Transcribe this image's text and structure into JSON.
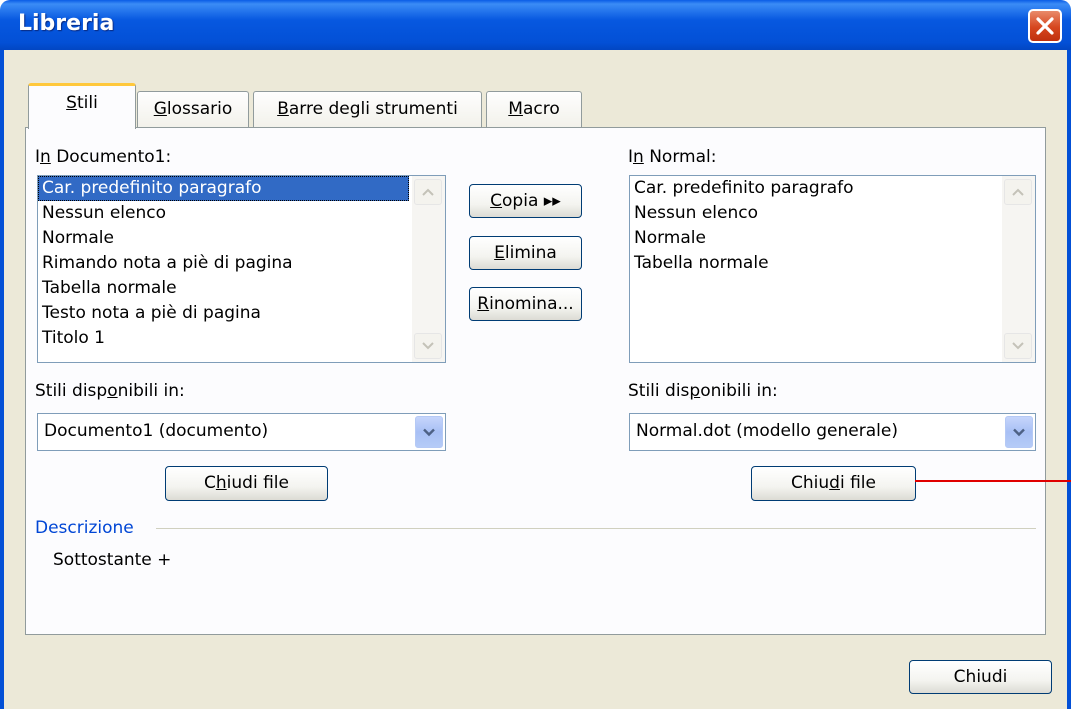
{
  "window": {
    "title": "Libreria"
  },
  "tabs": [
    {
      "label": "Stili",
      "mnemonic": "S",
      "rest": "tili",
      "active": true
    },
    {
      "label": "Glossario",
      "mnemonic": "G",
      "rest": "lossario",
      "active": false
    },
    {
      "label": "Barre degli strumenti",
      "mnemonic": "B",
      "rest": "arre degli strumenti",
      "active": false
    },
    {
      "label": "Macro",
      "mnemonic": "M",
      "rest": "acro",
      "active": false
    }
  ],
  "left": {
    "label_pre": "I",
    "label_mn": "n",
    "label_post": " Documento1:",
    "items": [
      "Car. predefinito paragrafo",
      "Nessun elenco",
      "Normale",
      "Rimando nota a piè di pagina",
      "Tabella normale",
      "Testo nota a piè di pagina",
      "Titolo 1"
    ],
    "selected_index": 0,
    "avail_pre": "Stili disp",
    "avail_mn": "o",
    "avail_post": "nibili in:",
    "combo_value": "Documento1 (documento)",
    "close_pre": "C",
    "close_mn": "h",
    "close_post": "iudi file"
  },
  "right": {
    "label_pre": "I",
    "label_mn": "n",
    "label_post": " Normal:",
    "items": [
      "Car. predefinito paragrafo",
      "Nessun elenco",
      "Normale",
      "Tabella normale"
    ],
    "avail_pre": "Stili dis",
    "avail_mn": "p",
    "avail_post": "onibili in:",
    "combo_value": "Normal.dot (modello generale)",
    "close_pre": "Chiu",
    "close_mn": "d",
    "close_post": "i file"
  },
  "actions": {
    "copy_mn": "C",
    "copy_rest": "opia ▸▸",
    "delete_mn": "E",
    "delete_rest": "limina",
    "rename_mn": "R",
    "rename_rest": "inomina..."
  },
  "description": {
    "heading": "Descrizione",
    "text": "Sottostante +",
    "heading_color": "#0046d5"
  },
  "footer": {
    "close_label": "Chiudi"
  }
}
